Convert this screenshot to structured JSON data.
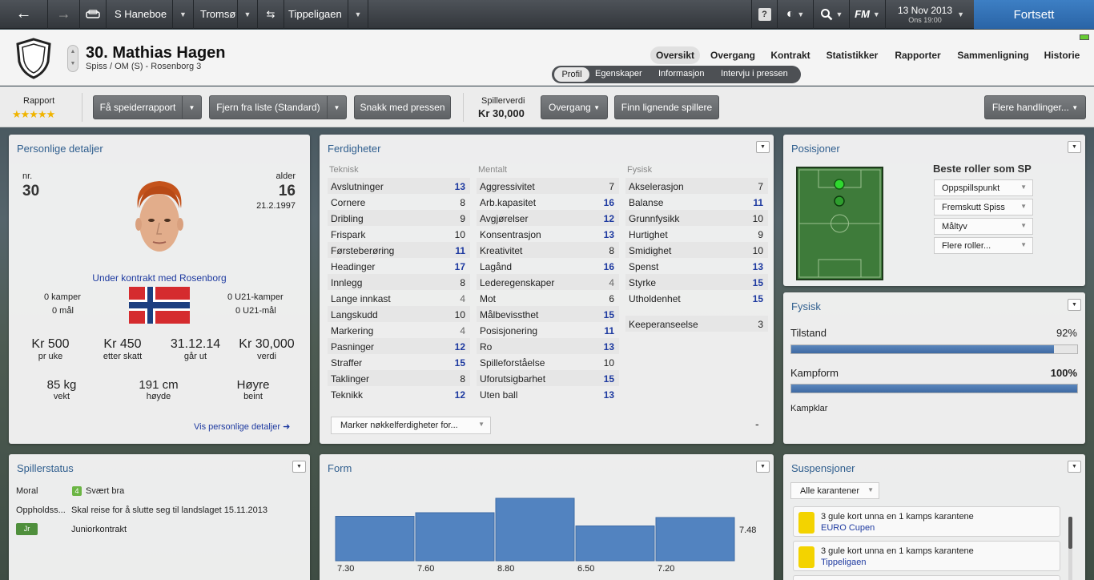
{
  "topbar": {
    "back_label": "←",
    "forward_label": "→",
    "manager": "S Haneboe",
    "club": "Tromsø",
    "league": "Tippeligaen",
    "help_label": "?",
    "date": "13 Nov 2013",
    "day_time": "Ons 19:00",
    "fm_label": "FM",
    "continue_label": "Fortsett"
  },
  "player": {
    "name": "30. Mathias Hagen",
    "position_club": "Spiss / OM (S) - Rosenborg 3"
  },
  "nav": {
    "main_tabs": [
      "Oversikt",
      "Overgang",
      "Kontrakt",
      "Statistikker",
      "Rapporter",
      "Sammenligning",
      "Historie"
    ],
    "active_main_tab": "Oversikt",
    "sub_tabs": [
      "Profil",
      "Egenskaper",
      "Informasjon",
      "Intervju i pressen"
    ],
    "active_sub_tab": "Profil"
  },
  "toolbar": {
    "report_label": "Rapport",
    "report_stars": 5,
    "scout_report": "Få speiderrapport",
    "remove_list": "Fjern fra liste (Standard)",
    "talk_press": "Snakk med pressen",
    "value_label": "Spillerverdi",
    "value": "Kr 30,000",
    "transfer": "Overgang",
    "find_similar": "Finn lignende spillere",
    "more_actions": "Flere handlinger..."
  },
  "personal": {
    "title": "Personlige detaljer",
    "nr_label": "nr.",
    "nr": "30",
    "age_label": "alder",
    "age": "16",
    "dob": "21.2.1997",
    "contract_text": "Under kontrakt med Rosenborg",
    "caps": "0 kamper",
    "goals": "0 mål",
    "u21_caps": "0 U21-kamper",
    "u21_goals": "0 U21-mål",
    "wage": "Kr 500",
    "wage_label": "pr uke",
    "after_tax": "Kr 450",
    "after_tax_label": "etter skatt",
    "expires": "31.12.14",
    "expires_label": "går ut",
    "value": "Kr 30,000",
    "value_label": "verdi",
    "weight": "85 kg",
    "weight_label": "vekt",
    "height": "191 cm",
    "height_label": "høyde",
    "foot": "Høyre",
    "foot_label": "beint",
    "link": "Vis personlige detaljer"
  },
  "attributes": {
    "title": "Ferdigheter",
    "technical_label": "Teknisk",
    "mental_label": "Mentalt",
    "physical_label": "Fysisk",
    "technical": [
      {
        "name": "Avslutninger",
        "value": 13
      },
      {
        "name": "Cornere",
        "value": 8
      },
      {
        "name": "Dribling",
        "value": 9
      },
      {
        "name": "Frispark",
        "value": 10
      },
      {
        "name": "Førsteberøring",
        "value": 11
      },
      {
        "name": "Headinger",
        "value": 17
      },
      {
        "name": "Innlegg",
        "value": 8
      },
      {
        "name": "Lange innkast",
        "value": 4
      },
      {
        "name": "Langskudd",
        "value": 10
      },
      {
        "name": "Markering",
        "value": 4
      },
      {
        "name": "Pasninger",
        "value": 12
      },
      {
        "name": "Straffer",
        "value": 15
      },
      {
        "name": "Taklinger",
        "value": 8
      },
      {
        "name": "Teknikk",
        "value": 12
      }
    ],
    "mental": [
      {
        "name": "Aggressivitet",
        "value": 7
      },
      {
        "name": "Arb.kapasitet",
        "value": 16
      },
      {
        "name": "Avgjørelser",
        "value": 12
      },
      {
        "name": "Konsentrasjon",
        "value": 13
      },
      {
        "name": "Kreativitet",
        "value": 8
      },
      {
        "name": "Lagånd",
        "value": 16
      },
      {
        "name": "Lederegenskaper",
        "value": 4
      },
      {
        "name": "Mot",
        "value": 6
      },
      {
        "name": "Målbevissthet",
        "value": 15
      },
      {
        "name": "Posisjonering",
        "value": 11
      },
      {
        "name": "Ro",
        "value": 13
      },
      {
        "name": "Spilleforståelse",
        "value": 10
      },
      {
        "name": "Uforutsigbarhet",
        "value": 15
      },
      {
        "name": "Uten ball",
        "value": 13
      }
    ],
    "physical": [
      {
        "name": "Akselerasjon",
        "value": 7
      },
      {
        "name": "Balanse",
        "value": 11
      },
      {
        "name": "Grunnfysikk",
        "value": 10
      },
      {
        "name": "Hurtighet",
        "value": 9
      },
      {
        "name": "Smidighet",
        "value": 10
      },
      {
        "name": "Spenst",
        "value": 13
      },
      {
        "name": "Styrke",
        "value": 15
      },
      {
        "name": "Utholdenhet",
        "value": 15
      }
    ],
    "goalkeeping": {
      "name": "Keeperanseelse",
      "value": 3
    },
    "highlight_select": "Marker nøkkelferdigheter for...",
    "dash": "-"
  },
  "positions": {
    "title": "Posisjoner",
    "best_roles_title": "Beste roller som SP",
    "roles": [
      "Oppspillspunkt",
      "Fremskutt Spiss",
      "Måltyv",
      "Flere roller..."
    ]
  },
  "physical": {
    "title": "Fysisk",
    "condition_label": "Tilstand",
    "condition": "92%",
    "condition_fraction": 0.92,
    "match_fitness_label": "Kampform",
    "match_fitness": "100%",
    "match_fitness_fraction": 1.0,
    "status": "Kampklar"
  },
  "status": {
    "title": "Spillerstatus",
    "morale_label": "Moral",
    "morale_level": "4",
    "morale": "Svært bra",
    "whereabouts_label": "Oppholdss...",
    "whereabouts": "Skal reise for å slutte seg til landslaget 15.11.2013",
    "contract_badge": "Jr",
    "contract": "Juniorkontrakt"
  },
  "form": {
    "title": "Form",
    "average": "7.48"
  },
  "chart_data": {
    "type": "bar",
    "categories": [
      "1",
      "2",
      "3",
      "4",
      "5"
    ],
    "values": [
      7.3,
      7.6,
      8.8,
      6.5,
      7.2
    ],
    "value_labels": [
      "7.30",
      "7.60",
      "8.80",
      "6.50",
      "7.20"
    ],
    "ylim": [
      0,
      10
    ],
    "bar_color": "#5283c0"
  },
  "suspensions": {
    "title": "Suspensjoner",
    "filter": "Alle karantener",
    "items": [
      {
        "text": "3 gule kort unna en 1 kamps karantene",
        "competition": "EURO Cupen"
      },
      {
        "text": "3 gule kort unna en 1 kamps karantene",
        "competition": "Tippeligaen"
      }
    ]
  },
  "colors": {
    "accent": "#2f5e8e",
    "highlight_value": "#1e3aa0",
    "continue_button": "#2f6fb5",
    "pitch": "#3d7a3a",
    "yellow_card": "#f3d300"
  }
}
